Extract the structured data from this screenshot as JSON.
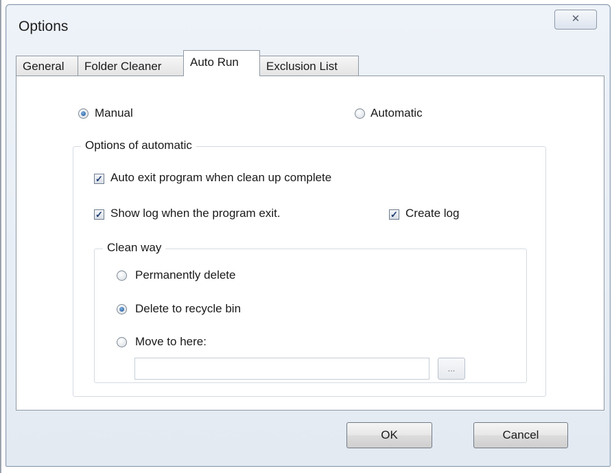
{
  "window": {
    "title": "Options",
    "close_glyph": "✕"
  },
  "tabs": [
    {
      "label": "General"
    },
    {
      "label": "Folder Cleaner"
    },
    {
      "label": "Auto Run",
      "active": true
    },
    {
      "label": "Exclusion List"
    }
  ],
  "auto_run": {
    "mode": {
      "manual_label": "Manual",
      "automatic_label": "Automatic",
      "selected": "Manual"
    },
    "options_group": {
      "legend": "Options of automatic",
      "auto_exit_label": "Auto exit program when clean up complete",
      "auto_exit_checked": true,
      "show_log_label": "Show log when the program exit.",
      "show_log_checked": true,
      "create_log_label": "Create log",
      "create_log_checked": true
    },
    "clean_way": {
      "legend": "Clean way",
      "permanent_label": "Permanently delete",
      "recycle_label": "Delete to recycle bin",
      "move_label": "Move to here:",
      "selected": "Delete to recycle bin",
      "move_path_value": "",
      "browse_label": "..."
    }
  },
  "footer": {
    "ok_label": "OK",
    "cancel_label": "Cancel"
  },
  "colors": {
    "window_chrome": "#e3eaf2",
    "panel_bg": "#ffffff",
    "radio_selected": "#1c4f8c",
    "check_mark": "#1d3a70"
  }
}
